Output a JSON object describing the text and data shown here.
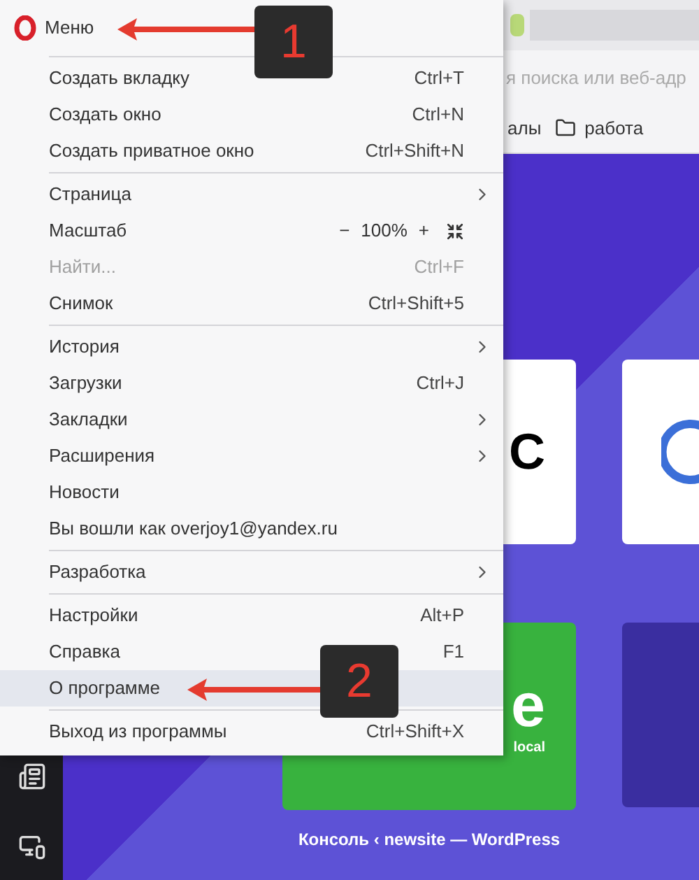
{
  "browser": {
    "address_bar": {
      "placeholder": "я поиска или веб-адр"
    },
    "bookmarks": [
      {
        "label": "алы",
        "kind": "link"
      },
      {
        "label": "работа",
        "kind": "folder"
      }
    ],
    "speed_dial": [
      {
        "kind": "letter",
        "text": "C"
      },
      {
        "kind": "logo"
      },
      {
        "kind": "site",
        "text": "e",
        "subtext": "local",
        "caption": "Консоль ‹ newsite — WordPress"
      },
      {
        "kind": "dark"
      }
    ]
  },
  "menu": {
    "title": "Меню",
    "groups": [
      [
        {
          "kind": "item",
          "label": "Создать вкладку",
          "shortcut": "Ctrl+T",
          "disabled": false,
          "highlighted": false
        },
        {
          "kind": "item",
          "label": "Создать окно",
          "shortcut": "Ctrl+N",
          "disabled": false,
          "highlighted": false
        },
        {
          "kind": "item",
          "label": "Создать приватное окно",
          "shortcut": "Ctrl+Shift+N",
          "disabled": false,
          "highlighted": false
        }
      ],
      [
        {
          "kind": "item",
          "label": "Страница",
          "disabled": false,
          "highlighted": false,
          "submenu": true
        },
        {
          "kind": "zoom",
          "label": "Масштаб",
          "minus": "−",
          "value": "100%",
          "plus": "+",
          "disabled": false,
          "highlighted": false
        },
        {
          "kind": "item",
          "label": "Найти...",
          "shortcut": "Ctrl+F",
          "disabled": true,
          "highlighted": false
        },
        {
          "kind": "item",
          "label": "Снимок",
          "shortcut": "Ctrl+Shift+5",
          "disabled": false,
          "highlighted": false
        }
      ],
      [
        {
          "kind": "item",
          "label": "История",
          "disabled": false,
          "highlighted": false,
          "submenu": true
        },
        {
          "kind": "item",
          "label": "Загрузки",
          "shortcut": "Ctrl+J",
          "disabled": false,
          "highlighted": false
        },
        {
          "kind": "item",
          "label": "Закладки",
          "disabled": false,
          "highlighted": false,
          "submenu": true
        },
        {
          "kind": "item",
          "label": "Расширения",
          "disabled": false,
          "highlighted": false,
          "submenu": true
        },
        {
          "kind": "item",
          "label": "Новости",
          "disabled": false,
          "highlighted": false
        },
        {
          "kind": "item",
          "label": "Вы вошли как overjoy1@yandex.ru",
          "disabled": false,
          "highlighted": false
        }
      ],
      [
        {
          "kind": "item",
          "label": "Разработка",
          "disabled": false,
          "highlighted": false,
          "submenu": true
        }
      ],
      [
        {
          "kind": "item",
          "label": "Настройки",
          "shortcut": "Alt+P",
          "disabled": false,
          "highlighted": false
        },
        {
          "kind": "item",
          "label": "Справка",
          "shortcut": "F1",
          "disabled": false,
          "highlighted": false
        },
        {
          "kind": "item",
          "label": "О программе",
          "disabled": false,
          "highlighted": true
        }
      ],
      [
        {
          "kind": "item",
          "label": "Выход из программы",
          "shortcut": "Ctrl+Shift+X",
          "disabled": false,
          "highlighted": false
        }
      ]
    ]
  },
  "annotations": [
    {
      "number": "1"
    },
    {
      "number": "2"
    }
  ]
}
